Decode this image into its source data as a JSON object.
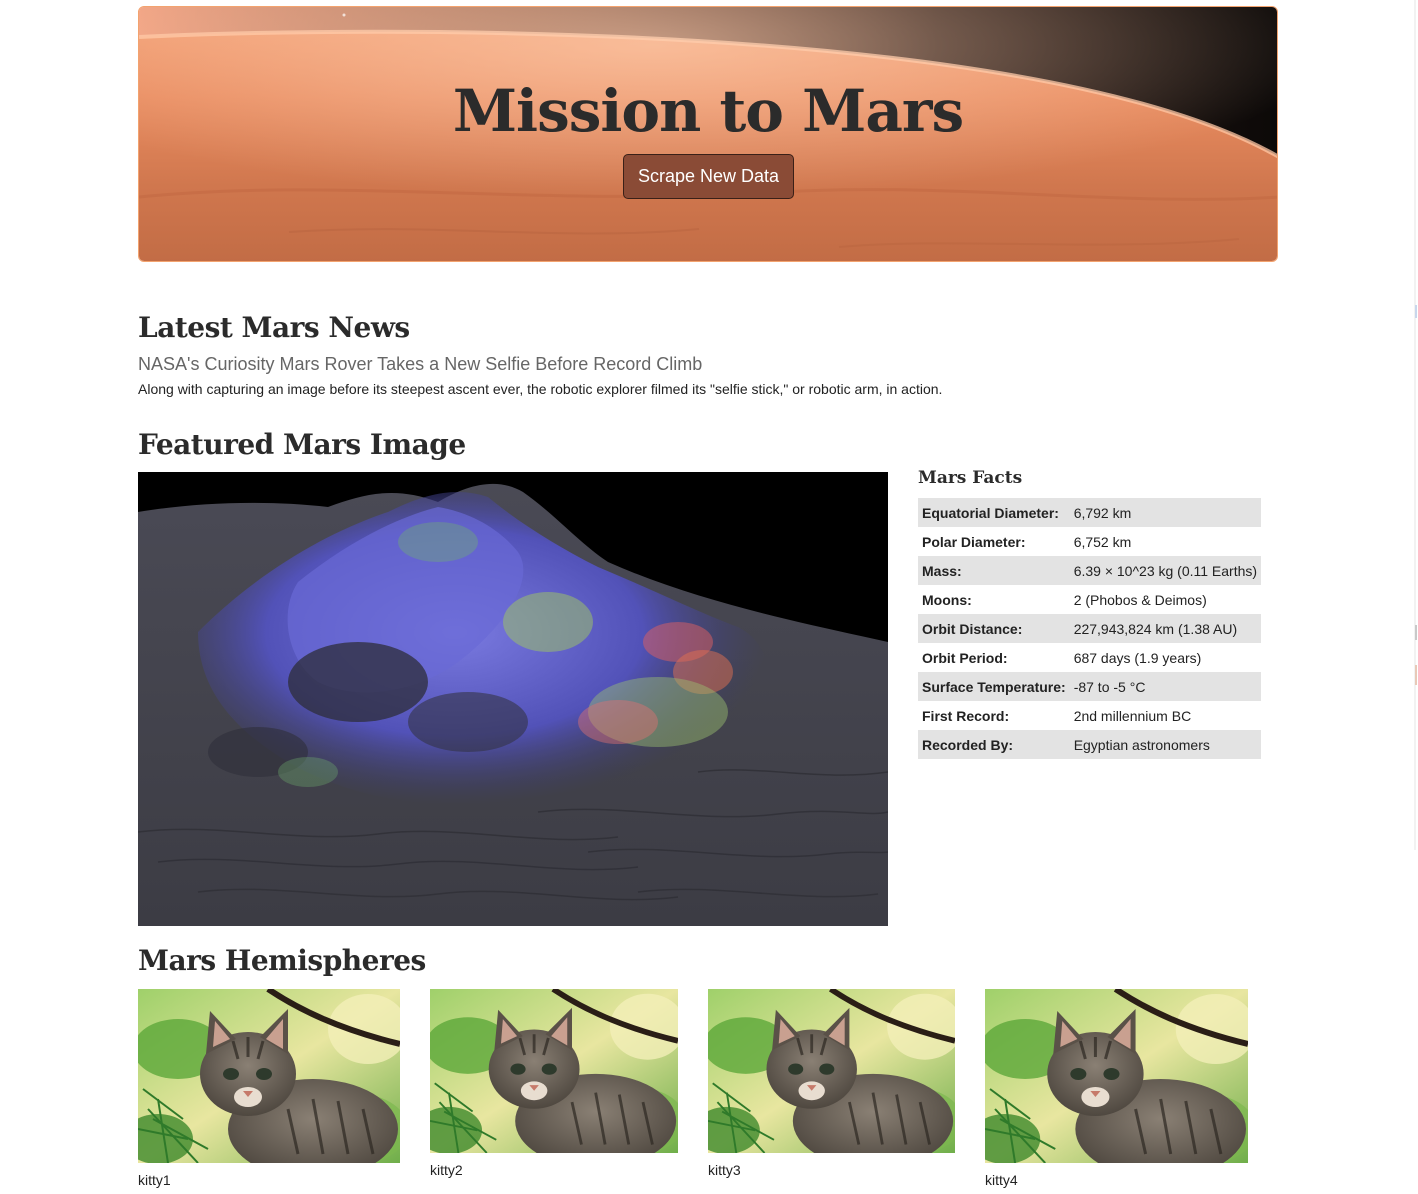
{
  "hero": {
    "title": "Mission to Mars",
    "button_label": "Scrape New Data"
  },
  "news": {
    "heading": "Latest Mars News",
    "title": "NASA's Curiosity Mars Rover Takes a New Selfie Before Record Climb",
    "teaser": "Along with capturing an image before its steepest ascent ever, the robotic explorer filmed its \"selfie stick,\" or robotic arm, in action."
  },
  "featured": {
    "heading": "Featured Mars Image"
  },
  "facts": {
    "heading": "Mars Facts",
    "rows": [
      {
        "label": "Equatorial Diameter:",
        "value": "6,792 km"
      },
      {
        "label": "Polar Diameter:",
        "value": "6,752 km"
      },
      {
        "label": "Mass:",
        "value": "6.39 × 10^23 kg (0.11 Earths)"
      },
      {
        "label": "Moons:",
        "value": "2 (Phobos & Deimos)"
      },
      {
        "label": "Orbit Distance:",
        "value": "227,943,824 km (1.38 AU)"
      },
      {
        "label": "Orbit Period:",
        "value": "687 days (1.9 years)"
      },
      {
        "label": "Surface Temperature:",
        "value": "-87 to -5 °C"
      },
      {
        "label": "First Record:",
        "value": "2nd millennium BC"
      },
      {
        "label": "Recorded By:",
        "value": "Egyptian astronomers"
      }
    ]
  },
  "hemispheres": {
    "heading": "Mars Hemispheres",
    "items": [
      {
        "title": "kitty1"
      },
      {
        "title": "kitty2"
      },
      {
        "title": "kitty3"
      },
      {
        "title": "kitty4"
      }
    ]
  },
  "colors": {
    "button_bg": "#8a4b36",
    "table_stripe": "#e3e3e3",
    "news_title": "#666666"
  }
}
